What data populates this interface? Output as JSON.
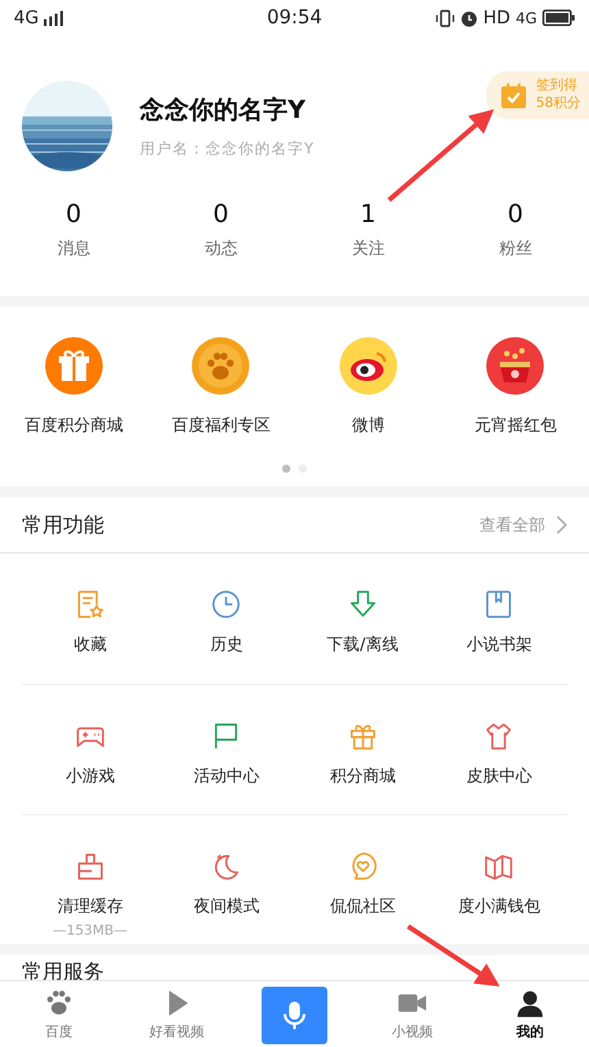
{
  "status_bar": {
    "network": "4G",
    "time": "09:54",
    "hd": "HD",
    "data": "4G"
  },
  "profile": {
    "name": "念念你的名字Y",
    "username": "用户名：念念你的名字Y",
    "checkin": {
      "title": "签到得",
      "reward": "58积分"
    }
  },
  "stats": [
    {
      "value": "0",
      "label": "消息"
    },
    {
      "value": "0",
      "label": "动态"
    },
    {
      "value": "1",
      "label": "关注"
    },
    {
      "value": "0",
      "label": "粉丝"
    }
  ],
  "banners": [
    {
      "label": "百度积分商城"
    },
    {
      "label": "百度福利专区"
    },
    {
      "label": "微博"
    },
    {
      "label": "元宵摇红包"
    }
  ],
  "pager": [
    {
      "selected": true
    },
    {
      "selected": false
    }
  ],
  "features": {
    "title": "常用功能",
    "more": "查看全部",
    "items": [
      {
        "label": "收藏"
      },
      {
        "label": "历史"
      },
      {
        "label": "下载/离线"
      },
      {
        "label": "小说书架"
      },
      {
        "label": "小游戏"
      },
      {
        "label": "活动中心"
      },
      {
        "label": "积分商城"
      },
      {
        "label": "皮肤中心"
      },
      {
        "label": "清理缓存",
        "detail": "—153MB—"
      },
      {
        "label": "夜间模式"
      },
      {
        "label": "侃侃社区"
      },
      {
        "label": "度小满钱包"
      }
    ]
  },
  "services": {
    "title": "常用服务"
  },
  "nav": [
    {
      "kind": "tab",
      "label": "百度",
      "selected": false
    },
    {
      "kind": "tab",
      "label": "好看视频",
      "selected": false
    },
    {
      "kind": "voice",
      "selected": false
    },
    {
      "kind": "tab",
      "label": "小视频",
      "selected": false
    },
    {
      "kind": "tab",
      "label": "我的",
      "selected": true
    }
  ]
}
